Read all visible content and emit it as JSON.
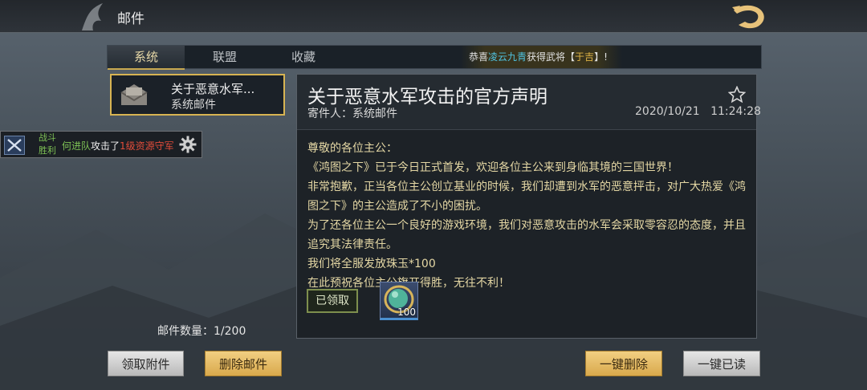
{
  "header": {
    "title": "邮件"
  },
  "tabs": [
    {
      "label": "系统"
    },
    {
      "label": "联盟"
    },
    {
      "label": "收藏"
    }
  ],
  "marquee": {
    "prefix": "恭喜",
    "player": "凌云九青",
    "middle": "获得武将【",
    "general": "于吉",
    "suffix": "】!"
  },
  "mail_list": {
    "items": [
      {
        "title": "关于恶意水军...",
        "subtitle": "系统邮件"
      }
    ],
    "count_label": "邮件数量：1/200"
  },
  "battle_notice": {
    "result_line1": "战斗",
    "result_line2": "胜利",
    "team": "何进队",
    "action": "攻击了",
    "target": "1级资源守军"
  },
  "mail_detail": {
    "title": "关于恶意水军攻击的官方声明",
    "sender": "寄件人：系统邮件",
    "date": "2020/10/21",
    "time": "11:24:28",
    "body": [
      "尊敬的各位主公：",
      "《鸿图之下》已于今日正式首发，欢迎各位主公来到身临其境的三国世界！",
      "非常抱歉，正当各位主公创立基业的时候，我们却遭到水军的恶意抨击，对广大热爱《鸿图之下》的主公造成了不小的困扰。",
      "为了还各位主公一个良好的游戏环境，我们对恶意攻击的水军会采取零容忍的态度，并且追究其法律责任。",
      "我们将全服发放珠玉*100",
      "在此预祝各位主公旗开得胜，无往不利！"
    ],
    "claimed_label": "已领取",
    "attachment": {
      "icon": "jade-orb-icon",
      "quantity": "100"
    }
  },
  "buttons": {
    "claim_attachments": "领取附件",
    "delete_mail": "删除邮件",
    "delete_all": "一键删除",
    "mark_all_read": "一键已读"
  },
  "colors": {
    "accent_gold": "#d8b452",
    "victory_green": "#7ec255",
    "target_red": "#e24c3a",
    "player_blue": "#4fc2e0",
    "body_text": "#e4d7a4"
  }
}
